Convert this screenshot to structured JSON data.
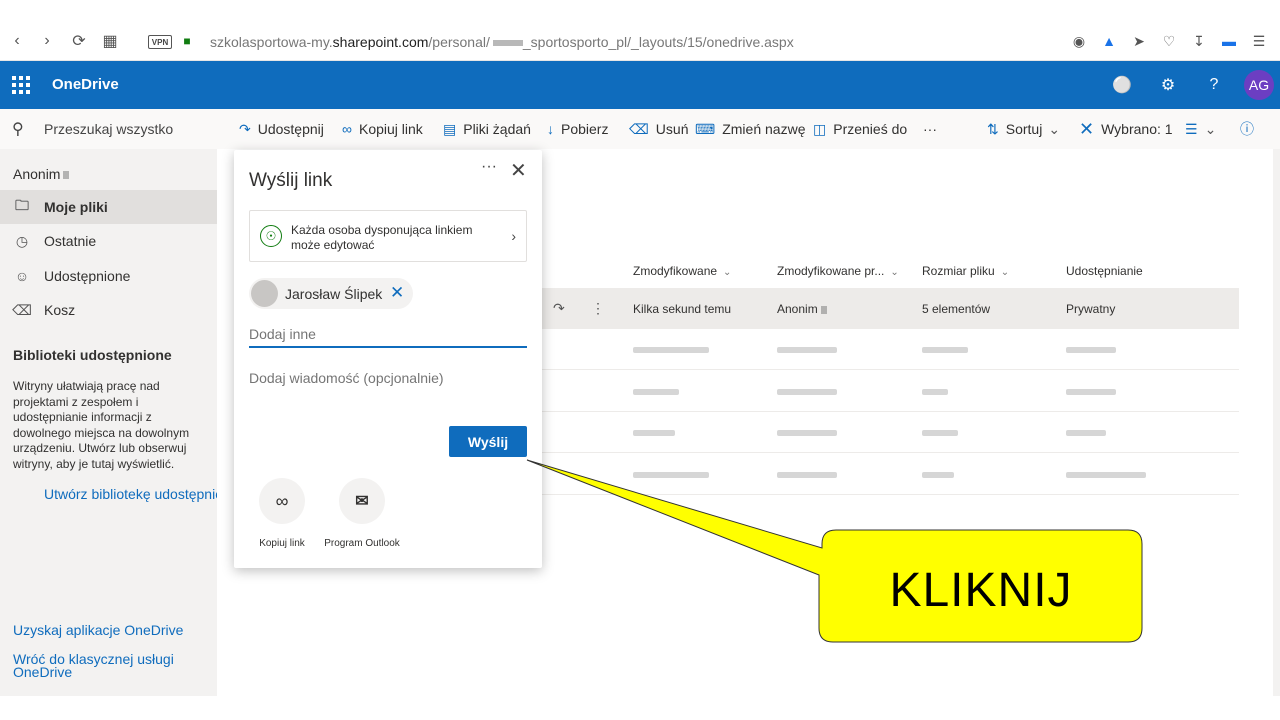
{
  "browser": {
    "vpn_label": "VPN",
    "url_prefix": "szkolasportowa-my.",
    "url_domain": "sharepoint.com",
    "url_path": "/personal/",
    "url_suffix": "_sportosporto_pl/_layouts/15/onedrive.aspx"
  },
  "suite": {
    "app_name": "OneDrive",
    "avatar_initials": "AG",
    "help_label": "?"
  },
  "left_nav": {
    "search_label": "Przeszukaj wszystko",
    "user_name": "Anonim",
    "items": [
      {
        "label": "Moje pliki",
        "icon": "folder-icon"
      },
      {
        "label": "Ostatnie",
        "icon": "clock-icon"
      },
      {
        "label": "Udostępnione",
        "icon": "people-icon"
      },
      {
        "label": "Kosz",
        "icon": "trash-icon"
      }
    ],
    "libraries_title": "Biblioteki udostępnione",
    "libraries_desc": "Witryny ułatwiają pracę nad projektami z zespołem i udostępnianie informacji z dowolnego miejsca na dowolnym urządzeniu. Utwórz lub obserwuj witryny, aby je tutaj wyświetlić.",
    "create_library_link": "Utwórz bibliotekę udostępnioną",
    "get_app_link": "Uzyskaj aplikacje OneDrive",
    "classic_link": "Wróć do klasycznej usługi OneDrive"
  },
  "command_bar": {
    "share": "Udostępnij",
    "copy_link": "Kopiuj link",
    "request_files": "Pliki żądań",
    "download": "Pobierz",
    "delete": "Usuń",
    "rename": "Zmień nazwę",
    "move_to": "Przenieś do",
    "more": "···",
    "sort": "Sortuj",
    "selected": "Wybrano: 1"
  },
  "file_list": {
    "columns": [
      "Zmodyfikowane",
      "Zmodyfikowane pr...",
      "Rozmiar pliku",
      "Udostępnianie"
    ],
    "selected_row": {
      "modified": "Kilka sekund temu",
      "modified_by": "Anonim",
      "size": "5 elementów",
      "sharing": "Prywatny"
    }
  },
  "dialog": {
    "title": "Wyślij link",
    "more": "···",
    "permission_text": "Każda osoba dysponująca linkiem może edytować",
    "recipient": "Jarosław Ślipek",
    "add_placeholder": "Dodaj inne",
    "message_placeholder": "Dodaj wiadomość (opcjonalnie)",
    "send_label": "Wyślij",
    "options": [
      {
        "label": "Kopiuj link",
        "icon": "link-icon"
      },
      {
        "label": "Program Outlook",
        "icon": "outlook-icon"
      }
    ]
  },
  "callout": {
    "text": "KLIKNIJ",
    "color": "#ffff00"
  },
  "colors": {
    "brand": "#0f6cbd",
    "nav_bg": "#f3f2f1"
  }
}
